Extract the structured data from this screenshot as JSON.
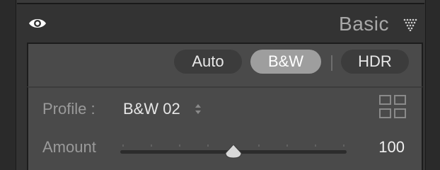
{
  "panel": {
    "title": "Basic",
    "visibility_icon": "eye-icon",
    "menu_icon": "triangle-dots-icon"
  },
  "treatment": {
    "buttons": [
      {
        "label": "Auto",
        "selected": false
      },
      {
        "label": "B&W",
        "selected": true
      },
      {
        "label": "HDR",
        "selected": false
      }
    ]
  },
  "profile": {
    "label": "Profile :",
    "value": "B&W 02",
    "stepper_icon": "up-down-chevron-icon",
    "browser_icon": "grid-icon"
  },
  "amount": {
    "label": "Amount",
    "value": "100",
    "slider_fraction": 0.5
  },
  "colors": {
    "selected_button": "#9e9e9e",
    "button": "#3c3c3c",
    "panel_bg": "#4a4a4a"
  }
}
